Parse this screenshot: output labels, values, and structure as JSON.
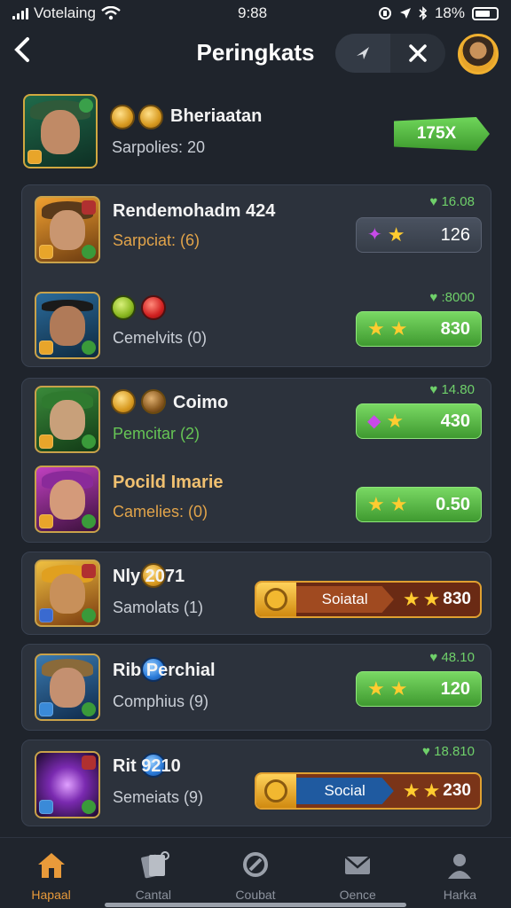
{
  "status_bar": {
    "carrier": "Votelaing",
    "time": "9:88",
    "battery": "18%"
  },
  "header": {
    "title": "Peringkats"
  },
  "me": {
    "name": "Bheriaatan",
    "subtitle": "Sarpolies: 20",
    "score": "175X"
  },
  "cards": [
    {
      "rows": [
        {
          "name": "Rendemohadm 424",
          "subtitle": "Sarpciat: (6)",
          "subtitle_color": "orange",
          "score": "16.08",
          "pill_style": "gray",
          "pill_value": "126"
        },
        {
          "name": "",
          "subtitle": "Cemelvits (0)",
          "subtitle_color": "default",
          "score": ":8000",
          "pill_style": "green",
          "pill_value": "830"
        }
      ]
    },
    {
      "rows": [
        {
          "name": "Coimo",
          "subtitle": "Pemcitar (2)",
          "subtitle_color": "green",
          "score": "14.80",
          "pill_style": "green",
          "pill_value": "430"
        },
        {
          "name": "Pocild Imarie",
          "subtitle": "Camelies: (0)",
          "subtitle_color": "orange",
          "score": "",
          "pill_style": "green",
          "pill_value": "0.50"
        }
      ]
    },
    {
      "rows": [
        {
          "name": "Nly  2071",
          "subtitle": "Samolats (1)",
          "subtitle_color": "default",
          "score": "",
          "bar_label": "Soiatal",
          "bar_value": "830",
          "bar_color": "#a04a20"
        }
      ]
    },
    {
      "rows": [
        {
          "name": "Rib  Perchial",
          "subtitle": "Comphius (9)",
          "subtitle_color": "default",
          "score": "48.10",
          "pill_style": "green",
          "pill_value": "120"
        }
      ]
    },
    {
      "rows": [
        {
          "name": "Rit  9210",
          "subtitle": "Semeiats (9)",
          "subtitle_color": "default",
          "score": "18.810",
          "bar_label": "Social",
          "bar_value": "230",
          "bar_color": "#1f5aa0"
        }
      ]
    }
  ],
  "bottom_nav": [
    {
      "label": "Hapaal",
      "icon": "home-icon",
      "active": true
    },
    {
      "label": "Cantal",
      "icon": "cards-icon",
      "active": false
    },
    {
      "label": "Coubat",
      "icon": "fight-icon",
      "active": false
    },
    {
      "label": "Oence",
      "icon": "mail-icon",
      "active": false
    },
    {
      "label": "Harka",
      "icon": "profile-icon",
      "active": false
    }
  ],
  "colors": {
    "accent_green": "#5fc44a",
    "accent_orange": "#e89a3a",
    "background": "#1f242c"
  }
}
